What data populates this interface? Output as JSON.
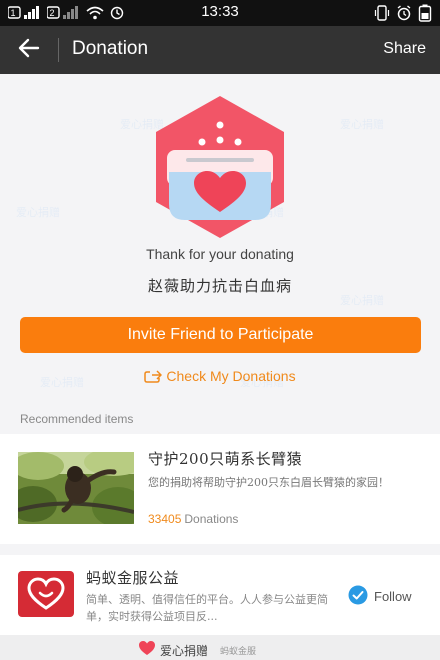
{
  "status_bar": {
    "time": "13:33",
    "signal_1": "1",
    "signal_2": "2"
  },
  "app_bar": {
    "back_icon": "arrow-left-icon",
    "title": "Donation",
    "share_label": "Share"
  },
  "watermark_text": "爱心捐赠",
  "hero": {
    "icon": "donation-box-heart-icon",
    "thanks_text": "Thank for your donating",
    "project_name": "赵薇助力抗击白血病"
  },
  "actions": {
    "invite_label": "Invite Friend to Participate",
    "check_label": "Check My Donations",
    "check_icon": "link-arrow-icon"
  },
  "recommended": {
    "section_title": "Recommended items",
    "item": {
      "title": "守护200只萌系长臂猿",
      "description": "您的捐助将帮助守护200只东白眉长臂猿的家园！",
      "donation_count": "33405",
      "donation_label": "Donations"
    }
  },
  "org": {
    "name": "蚂蚁金服公益",
    "description": "简单、透明、值得信任的平台。人人参与公益更简单，实时获得公益项目反...",
    "follow_label": "Follow"
  },
  "footer": {
    "brand": "爱心捐赠",
    "sub": "蚂蚁金服"
  },
  "colors": {
    "accent": "#fa7d0d",
    "link": "#f08a1c",
    "heart": "#ef4458",
    "follow": "#2a9ae3",
    "appbar": "#333333"
  }
}
